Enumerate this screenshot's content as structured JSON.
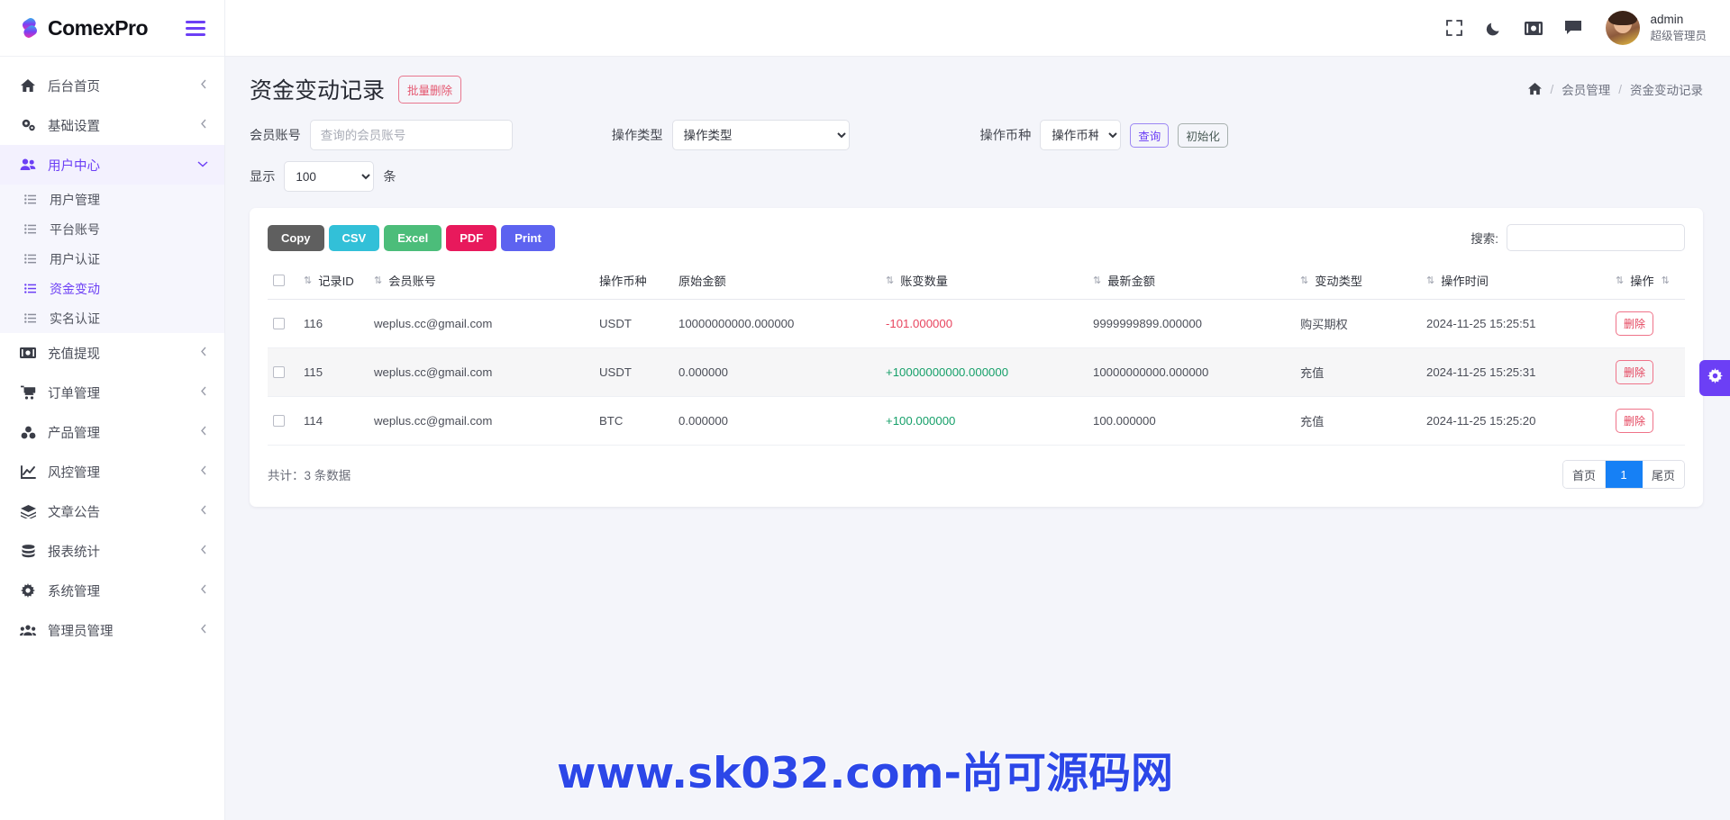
{
  "brand": {
    "name": "ComexPro",
    "logo_icon": "comexpro-logo-icon",
    "menu_icon": "hamburger-icon"
  },
  "topbar": {
    "icons": [
      {
        "name": "fullscreen-icon",
        "glyph": "fullscreen"
      },
      {
        "name": "dark-mode-icon",
        "glyph": "moon"
      },
      {
        "name": "money-icon",
        "glyph": "banknote"
      },
      {
        "name": "message-icon",
        "glyph": "chat"
      }
    ],
    "user": {
      "name": "admin",
      "role": "超级管理员",
      "avatar_icon": "avatar"
    }
  },
  "sidebar": {
    "items": [
      {
        "label": "后台首页",
        "icon": "home-icon",
        "arrow": "chevron-left-icon"
      },
      {
        "label": "基础设置",
        "icon": "gears-icon",
        "arrow": "chevron-left-icon"
      },
      {
        "label": "用户中心",
        "icon": "users-icon",
        "arrow": "chevron-down-icon",
        "active": true
      }
    ],
    "submenu": [
      {
        "label": "用户管理",
        "icon": "list-icon"
      },
      {
        "label": "平台账号",
        "icon": "list-icon"
      },
      {
        "label": "用户认证",
        "icon": "list-icon"
      },
      {
        "label": "资金变动",
        "icon": "list-icon",
        "current": true
      },
      {
        "label": "实名认证",
        "icon": "list-icon"
      }
    ],
    "items_rest": [
      {
        "label": "充值提现",
        "icon": "cash-icon",
        "arrow": "chevron-left-icon"
      },
      {
        "label": "订单管理",
        "icon": "cart-icon",
        "arrow": "chevron-left-icon"
      },
      {
        "label": "产品管理",
        "icon": "cubes-icon",
        "arrow": "chevron-left-icon"
      },
      {
        "label": "风控管理",
        "icon": "chart-line-icon",
        "arrow": "chevron-left-icon"
      },
      {
        "label": "文章公告",
        "icon": "layers-icon",
        "arrow": "chevron-left-icon"
      },
      {
        "label": "报表统计",
        "icon": "database-icon",
        "arrow": "chevron-left-icon"
      },
      {
        "label": "系统管理",
        "icon": "gear-icon",
        "arrow": "chevron-left-icon"
      },
      {
        "label": "管理员管理",
        "icon": "user-group-icon",
        "arrow": "chevron-left-icon"
      }
    ]
  },
  "page": {
    "title": "资金变动记录",
    "batch_delete_label": "批量删除",
    "breadcrumb": {
      "home_icon": "home-icon",
      "items": [
        "会员管理",
        "资金变动记录"
      ],
      "separator": "/"
    }
  },
  "filters": {
    "account_label": "会员账号",
    "account_placeholder": "查询的会员账号",
    "account_value": "",
    "optype_label": "操作类型",
    "optype_selected": "操作类型",
    "currency_label": "操作币种",
    "currency_selected": "操作币种",
    "query_label": "查询",
    "reset_label": "初始化",
    "show_label": "显示",
    "show_value": "100",
    "show_suffix": "条"
  },
  "toolbar": {
    "export_buttons": [
      {
        "label": "Copy",
        "color": "#5f5f5f"
      },
      {
        "label": "CSV",
        "color": "#32c0d8"
      },
      {
        "label": "Excel",
        "color": "#4cbd7a"
      },
      {
        "label": "PDF",
        "color": "#e8195c"
      },
      {
        "label": "Print",
        "color": "#5d63f0"
      }
    ],
    "search_label": "搜索:",
    "search_value": "",
    "search_placeholder": ""
  },
  "table": {
    "sort_icon": "sort-icon",
    "select_all_icon": "checkbox-icon",
    "columns": [
      "记录ID",
      "会员账号",
      "操作币种",
      "原始金额",
      "账变数量",
      "最新金额",
      "变动类型",
      "操作时间",
      "操作"
    ],
    "rows": [
      {
        "id": "116",
        "account": "weplus.cc@gmail.com",
        "currency": "USDT",
        "original": "10000000000.000000",
        "change": "-101.000000",
        "change_sign": "neg",
        "latest": "9999999899.000000",
        "type": "购买期权",
        "time": "2024-11-25 15:25:51",
        "action_label": "删除"
      },
      {
        "id": "115",
        "account": "weplus.cc@gmail.com",
        "currency": "USDT",
        "original": "0.000000",
        "change": "+10000000000.000000",
        "change_sign": "pos",
        "latest": "10000000000.000000",
        "type": "充值",
        "time": "2024-11-25 15:25:31",
        "action_label": "删除"
      },
      {
        "id": "114",
        "account": "weplus.cc@gmail.com",
        "currency": "BTC",
        "original": "0.000000",
        "change": "+100.000000",
        "change_sign": "pos",
        "latest": "100.000000",
        "type": "充值",
        "time": "2024-11-25 15:25:20",
        "action_label": "删除"
      }
    ],
    "total_text": "共计：3 条数据",
    "pagination": {
      "first": "首页",
      "current": "1",
      "last": "尾页"
    }
  },
  "fab": {
    "icon": "gear-icon"
  },
  "watermark": {
    "text": "www.sk032.com-尚可源码网",
    "color": "#2c47e8"
  }
}
